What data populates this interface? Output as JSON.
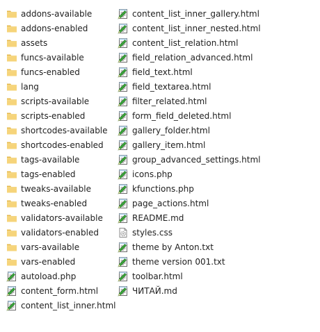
{
  "columns": [
    {
      "items": [
        {
          "name": "addons-available",
          "type": "folder"
        },
        {
          "name": "addons-enabled",
          "type": "folder"
        },
        {
          "name": "assets",
          "type": "folder"
        },
        {
          "name": "funcs-available",
          "type": "folder"
        },
        {
          "name": "funcs-enabled",
          "type": "folder"
        },
        {
          "name": "lang",
          "type": "folder"
        },
        {
          "name": "scripts-available",
          "type": "folder"
        },
        {
          "name": "scripts-enabled",
          "type": "folder"
        },
        {
          "name": "shortcodes-available",
          "type": "folder"
        },
        {
          "name": "shortcodes-enabled",
          "type": "folder"
        },
        {
          "name": "tags-available",
          "type": "folder"
        },
        {
          "name": "tags-enabled",
          "type": "folder"
        },
        {
          "name": "tweaks-available",
          "type": "folder"
        },
        {
          "name": "tweaks-enabled",
          "type": "folder"
        },
        {
          "name": "validators-available",
          "type": "folder"
        },
        {
          "name": "validators-enabled",
          "type": "folder"
        },
        {
          "name": "vars-available",
          "type": "folder"
        },
        {
          "name": "vars-enabled",
          "type": "folder"
        },
        {
          "name": "autoload.php",
          "type": "notepad"
        },
        {
          "name": "content_form.html",
          "type": "notepad"
        },
        {
          "name": "content_list_inner.html",
          "type": "notepad"
        }
      ]
    },
    {
      "items": [
        {
          "name": "content_list_inner_gallery.html",
          "type": "notepad"
        },
        {
          "name": "content_list_inner_nested.html",
          "type": "notepad"
        },
        {
          "name": "content_list_relation.html",
          "type": "notepad"
        },
        {
          "name": "field_relation_advanced.html",
          "type": "notepad"
        },
        {
          "name": "field_text.html",
          "type": "notepad"
        },
        {
          "name": "field_textarea.html",
          "type": "notepad"
        },
        {
          "name": "filter_related.html",
          "type": "notepad"
        },
        {
          "name": "form_field_deleted.html",
          "type": "notepad"
        },
        {
          "name": "gallery_folder.html",
          "type": "notepad"
        },
        {
          "name": "gallery_item.html",
          "type": "notepad"
        },
        {
          "name": "group_advanced_settings.html",
          "type": "notepad"
        },
        {
          "name": "icons.php",
          "type": "notepad"
        },
        {
          "name": "kfunctions.php",
          "type": "notepad"
        },
        {
          "name": "page_actions.html",
          "type": "notepad"
        },
        {
          "name": "README.md",
          "type": "notepad"
        },
        {
          "name": "styles.css",
          "type": "css"
        },
        {
          "name": "theme by Anton.txt",
          "type": "notepad"
        },
        {
          "name": "theme version 001.txt",
          "type": "notepad"
        },
        {
          "name": "toolbar.html",
          "type": "notepad"
        },
        {
          "name": "ЧИТАЙ.md",
          "type": "notepad"
        }
      ]
    }
  ],
  "icons": {
    "folder": "folder-icon",
    "notepad": "notepad-file-icon",
    "css": "css-file-icon"
  },
  "colors": {
    "text": "#1e1e1e",
    "folder_body": "#f6d47a",
    "folder_tab": "#e6b94c",
    "notepad_green": "#3aa53a",
    "notepad_lines": "#4a4a4a",
    "css_gear": "#9a9a9a"
  }
}
